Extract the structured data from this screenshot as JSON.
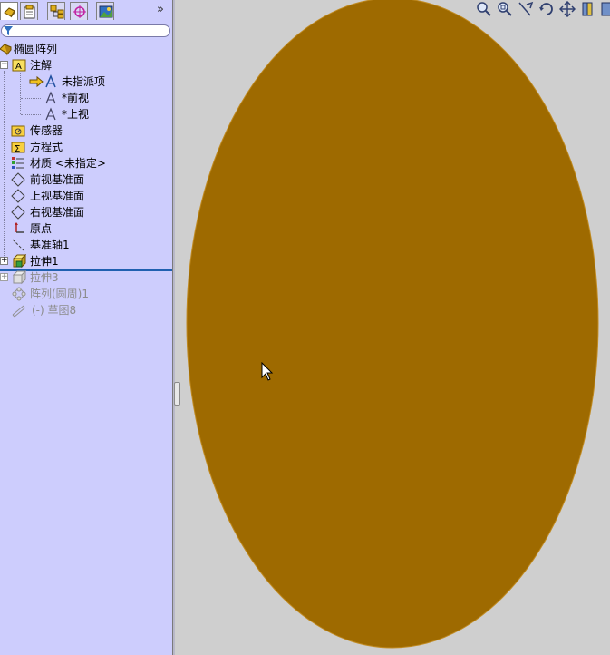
{
  "panel": {
    "tabs": [
      {
        "name": "featuremanager-tab-icon",
        "active": true
      },
      {
        "name": "propertymanager-tab-icon",
        "active": false
      },
      {
        "name": "configurationmanager-tab-icon",
        "active": false
      },
      {
        "name": "dimxpert-tab-icon",
        "active": false
      },
      {
        "name": "display-manager-tab-icon",
        "active": false
      }
    ],
    "expand_glyph": "»",
    "tree": {
      "root": "椭圆阵列",
      "annotations": "注解",
      "annotation_children": [
        "未指派项",
        "*前视",
        "*上视"
      ],
      "sensors": "传感器",
      "equations": "方程式",
      "material": "材质 <未指定>",
      "front_plane": "前视基准面",
      "top_plane": "上视基准面",
      "right_plane": "右视基准面",
      "origin": "原点",
      "axis": "基准轴1",
      "extrude1": "拉伸1",
      "extrude3": "拉伸3",
      "pattern": "阵列(圆周)1",
      "sketch": "(-) 草图8"
    }
  },
  "graphics": {
    "part_color": "#9e6a00",
    "background": "#cfcfcf",
    "view_tools": [
      "zoom-to-fit-icon",
      "zoom-to-area-icon",
      "zoom-in-out-icon",
      "rotate-icon",
      "pan-icon",
      "section-view-icon",
      "display-style-icon"
    ]
  },
  "colors": {
    "panel_bg": "#cdcdfd",
    "rollback_bar": "#2060b0",
    "suppressed_text": "#8c8c8c"
  }
}
